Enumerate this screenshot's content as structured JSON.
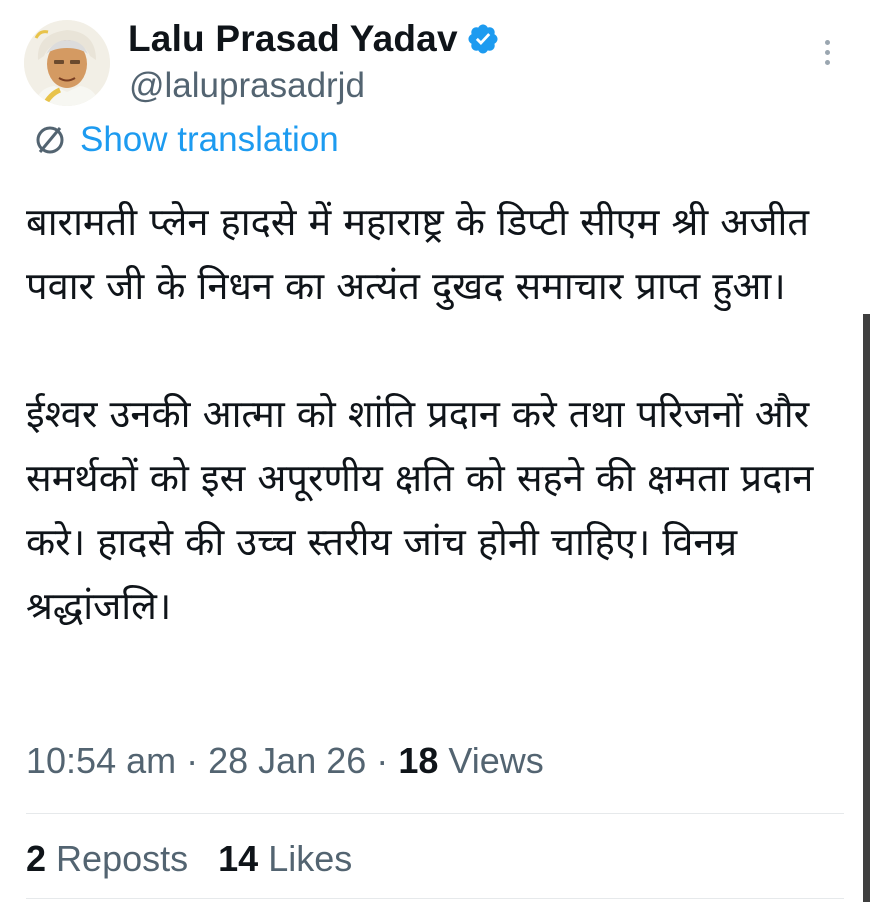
{
  "author": {
    "display_name": "Lalu Prasad Yadav",
    "handle": "@laluprasadrjd",
    "verified": true,
    "verified_color": "#1d9bf0"
  },
  "translation": {
    "label": "Show translation",
    "icon": "translate-icon"
  },
  "tweet": {
    "paragraphs": [
      "बारामती प्लेन हादसे में महाराष्ट्र के डिप्टी सीएम श्री अजीत पवार जी के निधन का अत्यंत दुखद समाचार प्राप्त हुआ।",
      "ईश्वर उनकी आत्मा को शांति प्रदान करे तथा परिजनों और समर्थकों को इस अपूरणीय क्षति को सहने की क्षमता प्रदान करे। हादसे की उच्च स्तरीय जांच होनी चाहिए। विनम्र श्रद्धांजलि।"
    ]
  },
  "meta": {
    "time": "10:54 am",
    "separator": "·",
    "date": "28 Jan 26",
    "views_count": "18",
    "views_label": "Views"
  },
  "stats": {
    "reposts_count": "2",
    "reposts_label": "Reposts",
    "likes_count": "14",
    "likes_label": "Likes"
  },
  "colors": {
    "link": "#1d9bf0",
    "secondary_text": "#536471",
    "primary_text": "#0f1419"
  }
}
